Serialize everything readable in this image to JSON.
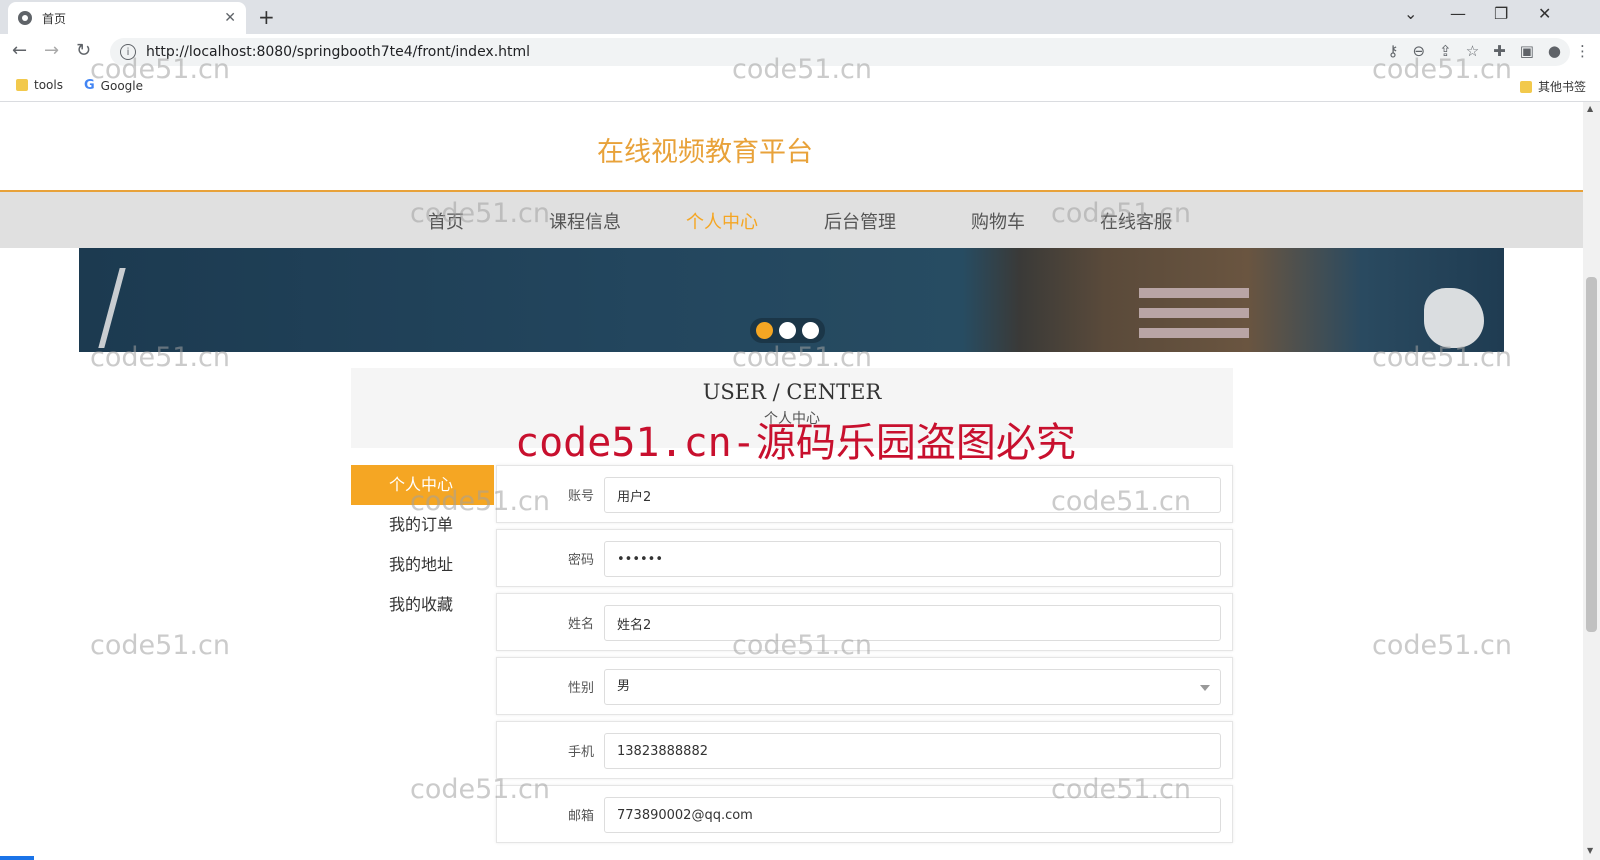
{
  "browser": {
    "tab_title": "首页",
    "url": "http://localhost:8080/springbooth7te4/front/index.html",
    "bookmarks": [
      "tools",
      "Google"
    ],
    "other_bookmarks": "其他书签"
  },
  "site": {
    "title": "在线视频教育平台",
    "nav": [
      "首页",
      "课程信息",
      "个人中心",
      "后台管理",
      "购物车",
      "在线客服"
    ],
    "active_nav": "个人中心"
  },
  "banner": {
    "dots": 3,
    "active_dot": 0
  },
  "user_center": {
    "title_en": "USER / CENTER",
    "title_cn": "个人中心",
    "menu": [
      "个人中心",
      "我的订单",
      "我的地址",
      "我的收藏"
    ],
    "active_menu": "个人中心",
    "fields": [
      {
        "label": "账号",
        "value": "用户2"
      },
      {
        "label": "密码",
        "value": "••••••"
      },
      {
        "label": "姓名",
        "value": "姓名2"
      },
      {
        "label": "性别",
        "value": "男",
        "type": "select"
      },
      {
        "label": "手机",
        "value": "13823888882"
      },
      {
        "label": "邮箱",
        "value": "773890002@qq.com"
      }
    ]
  },
  "watermark": {
    "text": "code51.cn",
    "notice": "code51.cn-源码乐园盗图必究"
  },
  "colors": {
    "accent": "#f5a623",
    "title": "#e8a23a",
    "notice": "#c8102e"
  }
}
